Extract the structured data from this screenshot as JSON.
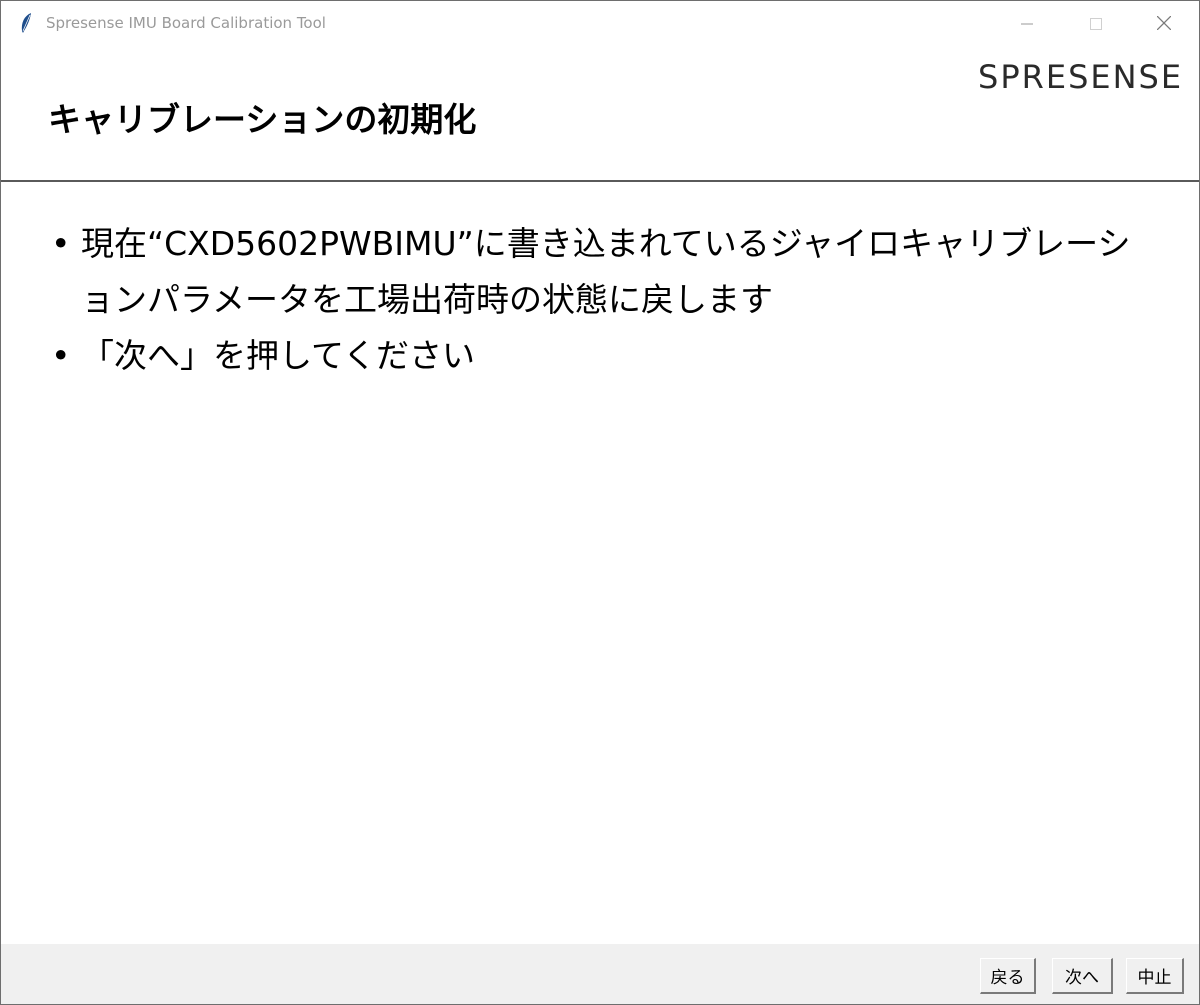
{
  "window": {
    "title": "Spresense IMU Board Calibration Tool"
  },
  "header": {
    "title": "キャリブレーションの初期化",
    "brand": "SPRESENSE"
  },
  "content": {
    "bullets": [
      {
        "marker": "•",
        "text": "現在“CXD5602PWBIMU”に書き込まれているジャイロキャリブレーションパラメータを工場出荷時の状態に戻します"
      },
      {
        "marker": "•",
        "text": "「次へ」を押してください"
      }
    ]
  },
  "footer": {
    "back_label": "戻る",
    "next_label": "次へ",
    "cancel_label": "中止"
  },
  "icons": {
    "app": "feather-icon",
    "minimize": "minimize-icon",
    "maximize": "maximize-icon",
    "close": "close-icon"
  },
  "colors": {
    "title_text": "#9a9a9a",
    "footer_bg": "#f0f0f0",
    "divider": "#5a5a5a"
  }
}
